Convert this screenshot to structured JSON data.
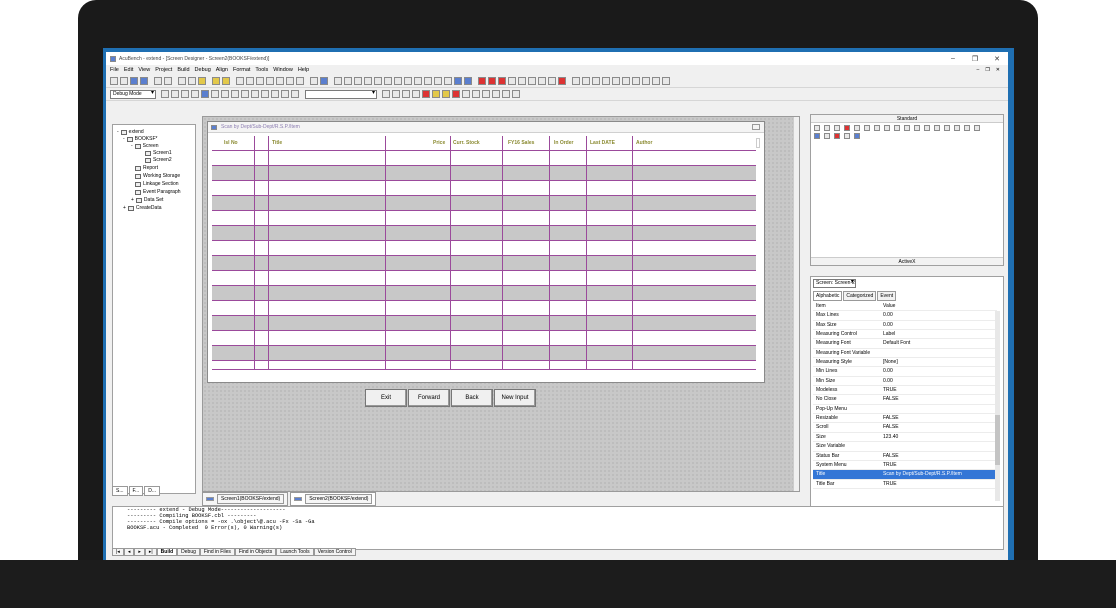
{
  "window": {
    "title": "AcuBench - extend - [Screen Designer - Screen2(BOOKSF/extend)]",
    "minimize": "–",
    "restore": "❐",
    "close": "✕"
  },
  "menu": {
    "items": [
      "File",
      "Edit",
      "View",
      "Project",
      "Build",
      "Debug",
      "Align",
      "Format",
      "Tools",
      "Window",
      "Help"
    ],
    "mdi_min": "–",
    "mdi_restore": "❐",
    "mdi_close": "✕"
  },
  "toolbar": {
    "mode_combo": "Debug Mode",
    "object_combo": ""
  },
  "tree": {
    "items": [
      {
        "label": "extend",
        "expander": "-"
      },
      {
        "label": "BOOKSF*",
        "expander": "-"
      },
      {
        "label": "Screen",
        "expander": "-"
      },
      {
        "label": "Screen1",
        "expander": ""
      },
      {
        "label": "Screen2",
        "expander": ""
      },
      {
        "label": "Report",
        "expander": ""
      },
      {
        "label": "Working Storage",
        "expander": ""
      },
      {
        "label": "Linkage Section",
        "expander": ""
      },
      {
        "label": "Event Paragraph",
        "expander": ""
      },
      {
        "label": "Data Set",
        "expander": "+"
      },
      {
        "label": "CreateData",
        "expander": "+"
      }
    ],
    "tabs": [
      "S...",
      "F...",
      "D..."
    ]
  },
  "form": {
    "title": "Scan by Dept/Sub-Dept/R.S.P./Item",
    "columns": [
      "Isl No",
      "Title",
      "Price",
      "Curr. Stock",
      "FY16 Sales",
      "In Order",
      "Last DATE",
      "Author"
    ],
    "buttons": [
      "Exit",
      "Forward",
      "Back",
      "New Input"
    ]
  },
  "doc_tabs": [
    "Screen1(BOOKSF/extend)",
    "Screen2(BOOKSF/extend)"
  ],
  "toolbox": {
    "header": "Standard",
    "footer": "ActiveX"
  },
  "properties": {
    "selector": "Screen: Screen-2",
    "tabs": [
      "Alphabetic",
      "Categorized",
      "Event"
    ],
    "rows": [
      {
        "k": "Item",
        "v": "Value"
      },
      {
        "k": "Max Lines",
        "v": "0.00"
      },
      {
        "k": "Max Size",
        "v": "0.00"
      },
      {
        "k": "Measuring Control",
        "v": "Label"
      },
      {
        "k": "Measuring Font",
        "v": "Default Font"
      },
      {
        "k": "Measuring Font Variable",
        "v": ""
      },
      {
        "k": "Measuring Style",
        "v": "[None]"
      },
      {
        "k": "Min Lines",
        "v": "0.00"
      },
      {
        "k": "Min Size",
        "v": "0.00"
      },
      {
        "k": "Modeless",
        "v": "TRUE"
      },
      {
        "k": "No Close",
        "v": "FALSE"
      },
      {
        "k": "Pop-Up Menu",
        "v": ""
      },
      {
        "k": "Resizable",
        "v": "FALSE"
      },
      {
        "k": "Scroll",
        "v": "FALSE"
      },
      {
        "k": "Size",
        "v": "123.40"
      },
      {
        "k": "Size Variable",
        "v": ""
      },
      {
        "k": "Status Bar",
        "v": "FALSE"
      },
      {
        "k": "System Menu",
        "v": "TRUE"
      },
      {
        "k": "Title",
        "v": "Scan by Dept/Sub-Dept/R.S.P./Item"
      },
      {
        "k": "Title Bar",
        "v": "TRUE"
      }
    ],
    "highlight_index": 18
  },
  "output": {
    "lines": [
      "--------- extend - Debug Mode--------------------",
      "--------- Compiling BOOKSF.cbl ---------",
      "--------- Compile options = -ox .\\object\\@.acu -Fx -Sa -Ga",
      "BOOKSF.acu - Completed  0 Error(s), 0 Warning(s)"
    ],
    "tabs": [
      "Build",
      "Debug",
      "Find in Files",
      "Find in Objects",
      "Launch Tools",
      "Version Control"
    ]
  },
  "colors": {
    "accent_blue": "#1f6fb2",
    "grid_line": "#9b4a9b",
    "header_text": "#8a8a30",
    "selection": "#3476d6"
  }
}
